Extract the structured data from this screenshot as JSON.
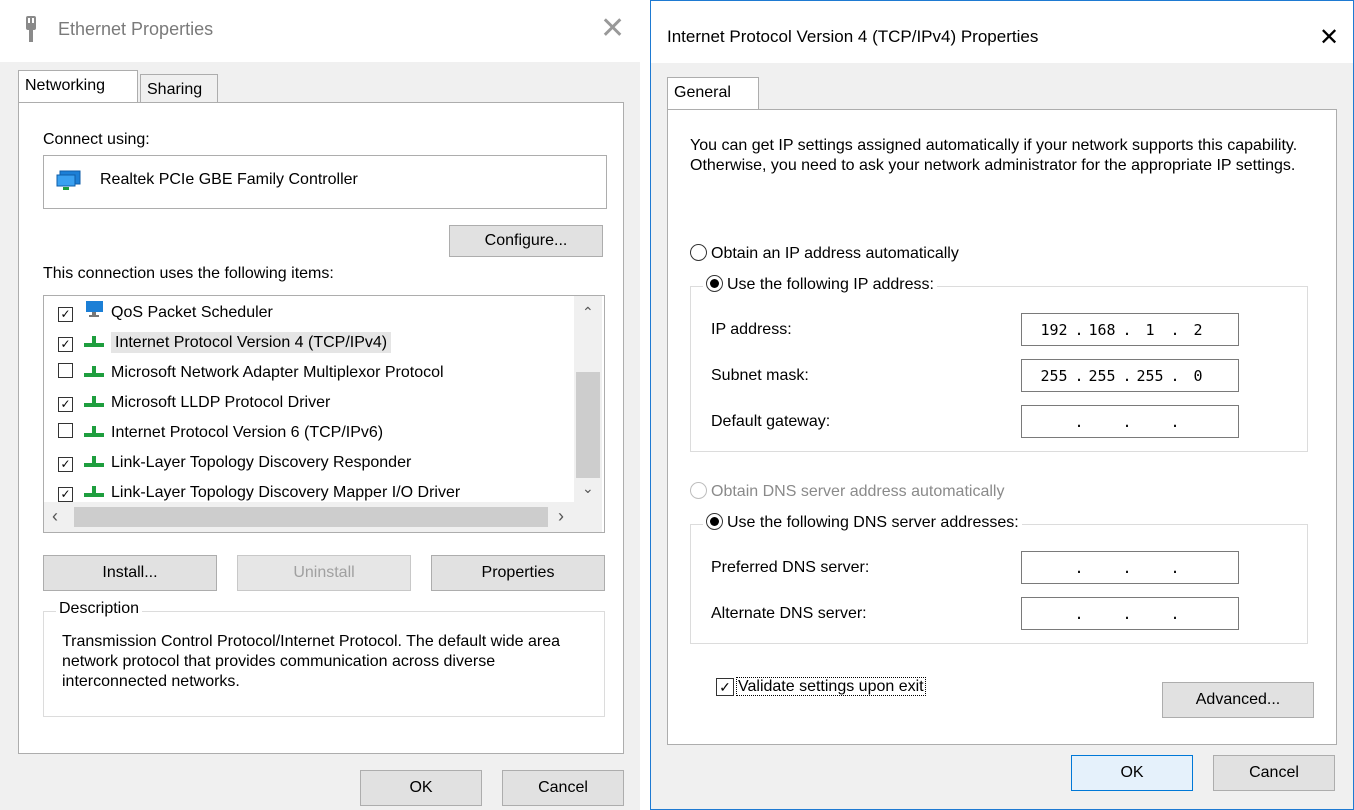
{
  "left": {
    "title": "Ethernet Properties",
    "tabs": [
      "Networking",
      "Sharing"
    ],
    "connect_using_label": "Connect using:",
    "adapter_name": "Realtek PCIe GBE Family Controller",
    "configure_label": "Configure...",
    "items_label": "This connection uses the following items:",
    "items": [
      {
        "label": "QoS Packet Scheduler",
        "checked": true,
        "icon": "monitor-icon"
      },
      {
        "label": "Internet Protocol Version 4 (TCP/IPv4)",
        "checked": true,
        "icon": "network-protocol-icon"
      },
      {
        "label": "Microsoft Network Adapter Multiplexor Protocol",
        "checked": false,
        "icon": "network-protocol-icon"
      },
      {
        "label": "Microsoft LLDP Protocol Driver",
        "checked": true,
        "icon": "network-protocol-icon"
      },
      {
        "label": "Internet Protocol Version 6 (TCP/IPv6)",
        "checked": false,
        "icon": "network-protocol-icon"
      },
      {
        "label": "Link-Layer Topology Discovery Responder",
        "checked": true,
        "icon": "network-protocol-icon"
      },
      {
        "label": "Link-Layer Topology Discovery Mapper I/O Driver",
        "checked": true,
        "icon": "network-protocol-icon"
      }
    ],
    "install_label": "Install...",
    "uninstall_label": "Uninstall",
    "properties_label": "Properties",
    "description_legend": "Description",
    "description_text": "Transmission Control Protocol/Internet Protocol. The default wide area network protocol that provides communication across diverse interconnected networks.",
    "ok_label": "OK",
    "cancel_label": "Cancel"
  },
  "right": {
    "title": "Internet Protocol Version 4 (TCP/IPv4) Properties",
    "tab": "General",
    "intro": "You can get IP settings assigned automatically if your network supports this capability. Otherwise, you need to ask your network administrator for the appropriate IP settings.",
    "obtain_ip_auto": "Obtain an IP address automatically",
    "use_following_ip": "Use the following IP address:",
    "ip_address_label": "IP address:",
    "ip_address": [
      "192",
      "168",
      "1",
      "2"
    ],
    "subnet_mask_label": "Subnet mask:",
    "subnet_mask": [
      "255",
      "255",
      "255",
      "0"
    ],
    "default_gateway_label": "Default gateway:",
    "default_gateway": [
      "",
      "",
      "",
      ""
    ],
    "obtain_dns_auto": "Obtain DNS server address automatically",
    "use_following_dns": "Use the following DNS server addresses:",
    "preferred_dns_label": "Preferred DNS server:",
    "preferred_dns": [
      "",
      "",
      "",
      ""
    ],
    "alternate_dns_label": "Alternate DNS server:",
    "alternate_dns": [
      "",
      "",
      "",
      ""
    ],
    "validate_label": "Validate settings upon exit",
    "validate_checked": true,
    "advanced_label": "Advanced...",
    "ok_label": "OK",
    "cancel_label": "Cancel"
  },
  "colors": {
    "accent": "#0078d7",
    "protocol_icon": "#1e9e3e",
    "monitor_icon": "#1c7fd6"
  }
}
